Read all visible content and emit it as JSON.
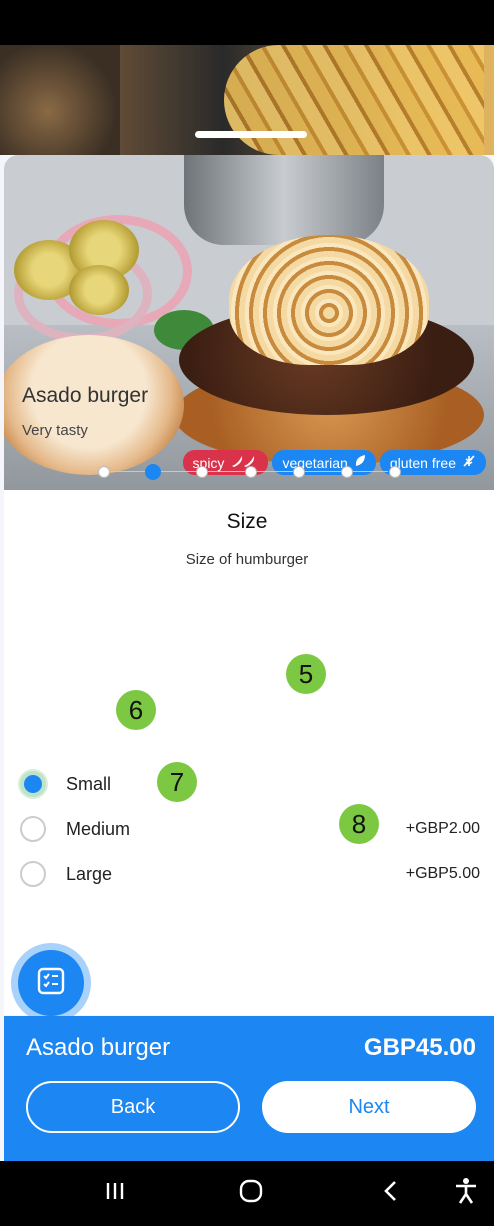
{
  "product": {
    "name": "Asado burger",
    "description": "Very tasty",
    "tags": [
      {
        "label": "spicy",
        "icon": "chili-icon",
        "color": "#d9324a"
      },
      {
        "label": "vegetarian",
        "icon": "leaf-icon",
        "color": "#1c86f2"
      },
      {
        "label": "gluten free",
        "icon": "no-wheat-icon",
        "color": "#1c86f2"
      }
    ]
  },
  "wizard": {
    "total_steps": 7,
    "current_step": 2,
    "title": "Size",
    "subtitle": "Size of humburger"
  },
  "options": [
    {
      "label": "Small",
      "price": "",
      "selected": true
    },
    {
      "label": "Medium",
      "price": "+GBP2.00",
      "selected": false
    },
    {
      "label": "Large",
      "price": "+GBP5.00",
      "selected": false
    }
  ],
  "markers": {
    "m5": "5",
    "m6": "6",
    "m7": "7",
    "m8": "8"
  },
  "footer": {
    "name": "Asado burger",
    "total": "GBP45.00",
    "back_label": "Back",
    "next_label": "Next"
  },
  "colors": {
    "accent": "#1c86f2",
    "spicy": "#d9324a",
    "marker": "#7cc843"
  },
  "nav": {
    "icons": [
      "recent-apps-icon",
      "home-icon",
      "back-arrow-icon",
      "accessibility-icon"
    ]
  }
}
